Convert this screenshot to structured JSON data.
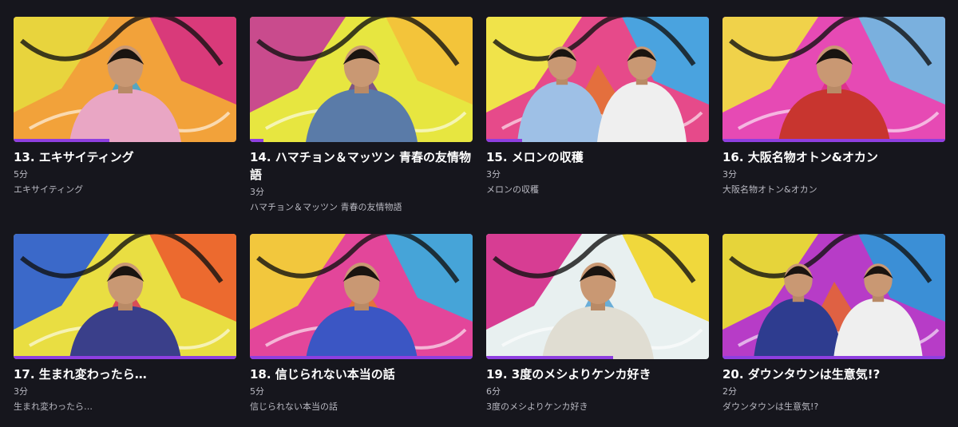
{
  "accent_color": "#8e3fe0",
  "episodes": [
    {
      "title": "13. エキサイティング",
      "duration": "5分",
      "description": "エキサイティング",
      "progress": 0.43,
      "thumb": {
        "bg": [
          "#f2a23a",
          "#e8d43d",
          "#d93a7a",
          "#3aa7d9"
        ],
        "people": 1,
        "shirt": "#e9a6c4"
      }
    },
    {
      "title": "14. ハマチョン＆マッツン 青春の友情物語",
      "duration": "3分",
      "description": "ハマチョン＆マッツン 青春の友情物語",
      "progress": 0.06,
      "thumb": {
        "bg": [
          "#e7e640",
          "#c94b8d",
          "#f3c43a",
          "#6b3c8f"
        ],
        "people": 1,
        "shirt": "#5a7ba8"
      }
    },
    {
      "title": "15. メロンの収穫",
      "duration": "3分",
      "description": "メロンの収穫",
      "progress": 0.16,
      "thumb": {
        "bg": [
          "#e64a8a",
          "#f0e34a",
          "#4aa3df",
          "#e3762f"
        ],
        "people": 2,
        "shirt": "#9ec0e6"
      }
    },
    {
      "title": "16. 大阪名物オトン&オカン",
      "duration": "3分",
      "description": "大阪名物オトン&オカン",
      "progress": 1.0,
      "thumb": {
        "bg": [
          "#e64ab4",
          "#f0d24a",
          "#7ab0de",
          "#d92d86"
        ],
        "people": 1,
        "shirt": "#c8352f"
      }
    },
    {
      "title": "17. 生まれ変わったら…",
      "duration": "3分",
      "description": "生まれ変わったら…",
      "progress": 1.0,
      "thumb": {
        "bg": [
          "#e9de42",
          "#3b69c9",
          "#ec6a2f",
          "#d6345c"
        ],
        "people": 1,
        "shirt": "#3a3f8a"
      }
    },
    {
      "title": "18. 信じられない本当の話",
      "duration": "5分",
      "description": "信じられない本当の話",
      "progress": 1.0,
      "thumb": {
        "bg": [
          "#e3469a",
          "#f2c73d",
          "#46a4d8",
          "#e37a2d"
        ],
        "people": 1,
        "shirt": "#3b56c4"
      }
    },
    {
      "title": "19. 3度のメシよりケンカ好き",
      "duration": "6分",
      "description": "3度のメシよりケンカ好き",
      "progress": 0.57,
      "thumb": {
        "bg": [
          "#e8f0f0",
          "#d73d93",
          "#f0d83c",
          "#54a2d4"
        ],
        "people": 1,
        "shirt": "#e0ddd2"
      }
    },
    {
      "title": "20. ダウンタウンは生意気!?",
      "duration": "2分",
      "description": "ダウンタウンは生意気!?",
      "progress": 1.0,
      "thumb": {
        "bg": [
          "#b73cc7",
          "#e6d43a",
          "#3b8fd6",
          "#e6672c"
        ],
        "people": 2,
        "shirt": "#2e3c8f"
      }
    }
  ]
}
